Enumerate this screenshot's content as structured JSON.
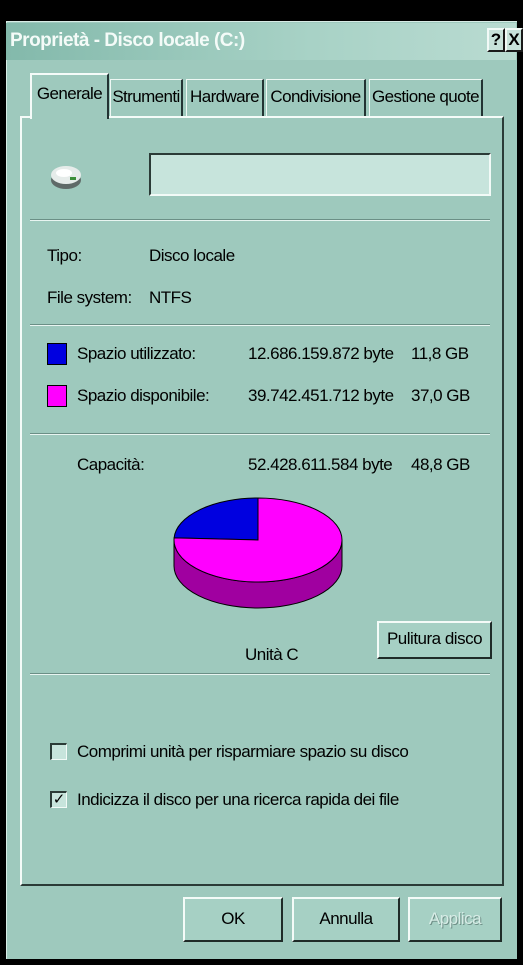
{
  "window": {
    "title": "Proprietà - Disco locale (C:)",
    "help_label": "?",
    "close_label": "X"
  },
  "tabs": [
    {
      "label": "Generale",
      "active": true
    },
    {
      "label": "Strumenti",
      "active": false
    },
    {
      "label": "Hardware",
      "active": false
    },
    {
      "label": "Condivisione",
      "active": false
    },
    {
      "label": "Gestione quote",
      "active": false
    }
  ],
  "drive": {
    "icon": "drive-icon",
    "name_value": "",
    "type_label": "Tipo:",
    "type_value": "Disco locale",
    "fs_label": "File system:",
    "fs_value": "NTFS"
  },
  "space": {
    "used_label": "Spazio utilizzato:",
    "used_bytes": "12.686.159.872 byte",
    "used_size": "11,8 GB",
    "used_color": "#0000e0",
    "free_label": "Spazio disponibile:",
    "free_bytes": "39.742.451.712 byte",
    "free_size": "37,0 GB",
    "free_color": "#ff00ff",
    "capacity_label": "Capacità:",
    "capacity_bytes": "52.428.611.584 byte",
    "capacity_size": "48,8 GB"
  },
  "chart_data": {
    "type": "pie",
    "categories": [
      "Spazio utilizzato",
      "Spazio disponibile"
    ],
    "values": [
      12686159872,
      39742451712
    ],
    "colors": [
      "#0000e0",
      "#ff00ff"
    ]
  },
  "drive_label": "Unità C",
  "cleanup_button": "Pulitura disco",
  "options": {
    "compress_label": "Comprimi unità per risparmiare spazio su disco",
    "compress_checked": false,
    "index_label": "Indicizza il disco per una ricerca rapida dei file",
    "index_checked": true
  },
  "footer": {
    "ok_label": "OK",
    "cancel_label": "Annulla",
    "apply_label": "Applica"
  }
}
